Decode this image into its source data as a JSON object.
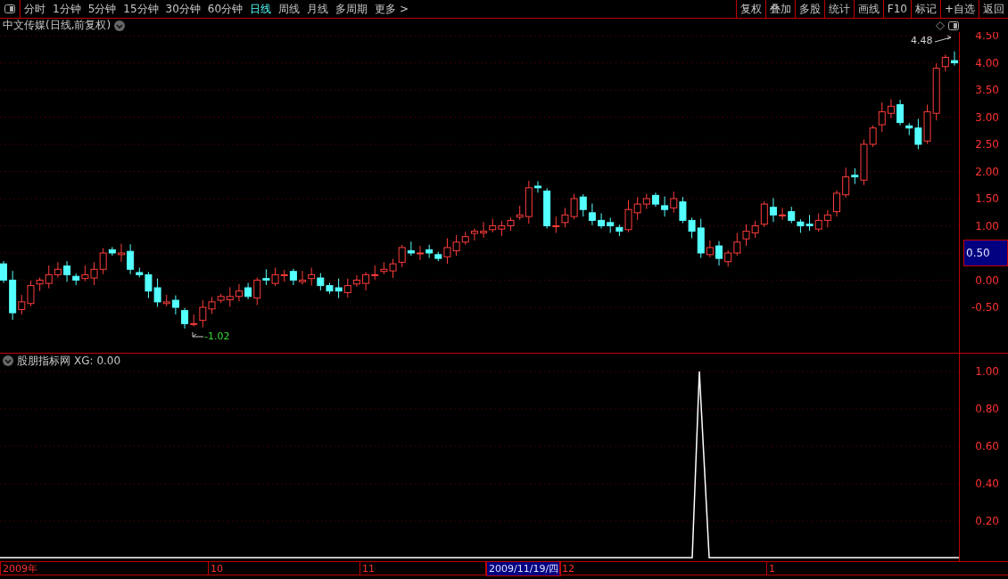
{
  "toolbar": {
    "periods": [
      {
        "label": "分时",
        "selected": false
      },
      {
        "label": "1分钟",
        "selected": false
      },
      {
        "label": "5分钟",
        "selected": false
      },
      {
        "label": "15分钟",
        "selected": false
      },
      {
        "label": "30分钟",
        "selected": false
      },
      {
        "label": "60分钟",
        "selected": false
      },
      {
        "label": "日线",
        "selected": true
      },
      {
        "label": "周线",
        "selected": false
      },
      {
        "label": "月线",
        "selected": false
      },
      {
        "label": "多周期",
        "selected": false
      },
      {
        "label": "更多 >",
        "selected": false
      }
    ],
    "buttons": [
      "复权",
      "叠加",
      "多股",
      "统计",
      "画线",
      "F10",
      "标记",
      "+自选",
      "返回"
    ]
  },
  "price_pane": {
    "title": "中文传媒(日线,前复权)",
    "high_label": "4.48",
    "low_label": "-1.02",
    "ticks": [
      {
        "label": "4.50",
        "cursor": false
      },
      {
        "label": "4.00",
        "cursor": false
      },
      {
        "label": "3.50",
        "cursor": false
      },
      {
        "label": "3.00",
        "cursor": false
      },
      {
        "label": "2.50",
        "cursor": false
      },
      {
        "label": "2.00",
        "cursor": false
      },
      {
        "label": "1.50",
        "cursor": false
      },
      {
        "label": "1.00",
        "cursor": false
      },
      {
        "label": "0.50",
        "cursor": true
      },
      {
        "label": "0.00",
        "cursor": false
      },
      {
        "label": "-0.50",
        "cursor": false
      }
    ]
  },
  "indicator_pane": {
    "name": "股朋指标网",
    "value": "XG: 0.00",
    "ticks": [
      "1.00",
      "0.80",
      "0.60",
      "0.40",
      "0.20"
    ]
  },
  "date_axis": [
    {
      "label": "2009年",
      "cursor": false
    },
    {
      "label": "10",
      "cursor": false
    },
    {
      "label": "11",
      "cursor": false
    },
    {
      "label": "2009/11/19/四",
      "cursor": true
    },
    {
      "label": "12",
      "cursor": false
    },
    {
      "label": "1",
      "cursor": false
    }
  ]
}
